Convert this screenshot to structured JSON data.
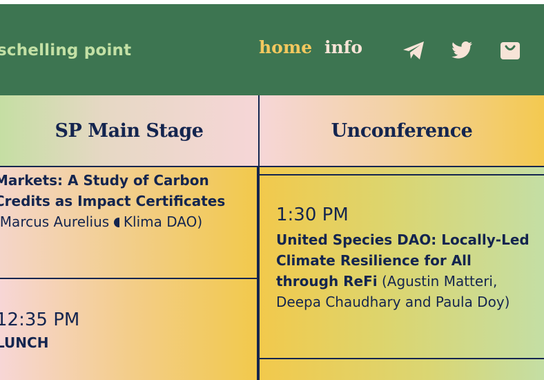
{
  "header": {
    "brand": "schelling point",
    "nav": {
      "home": "home",
      "info": "info"
    },
    "icons": [
      "telegram-icon",
      "twitter-icon",
      "shop-bag-icon"
    ]
  },
  "stages": {
    "main": "SP Main Stage",
    "unconference": "Unconference"
  },
  "schedule": {
    "main": {
      "talk1": {
        "title": "Markets: A Study of Carbon Credits as Impact Certificates",
        "speakers": "(Marcus Aurelius",
        "speakers_cont": "Klima DAO)"
      },
      "slot2": {
        "time": "12:35 PM",
        "title": "LUNCH"
      }
    },
    "unconference": {
      "slot1": {
        "time": "1:30 PM",
        "title": "United Species DAO: Locally-Led Climate Resilience for All through ReFi",
        "speakers": "(Agustin Matteri, Deepa Chaudhary and Paula Doy)"
      }
    }
  },
  "colors": {
    "header_bg": "#3d7551",
    "brand_text": "#c3e0a5",
    "nav_active": "#f3c85e",
    "nav_inactive": "#f7e4d7",
    "text_dark": "#14254f",
    "yellow": "#f2c94c",
    "pink": "#f6d6d7",
    "green": "#c4dea4"
  }
}
